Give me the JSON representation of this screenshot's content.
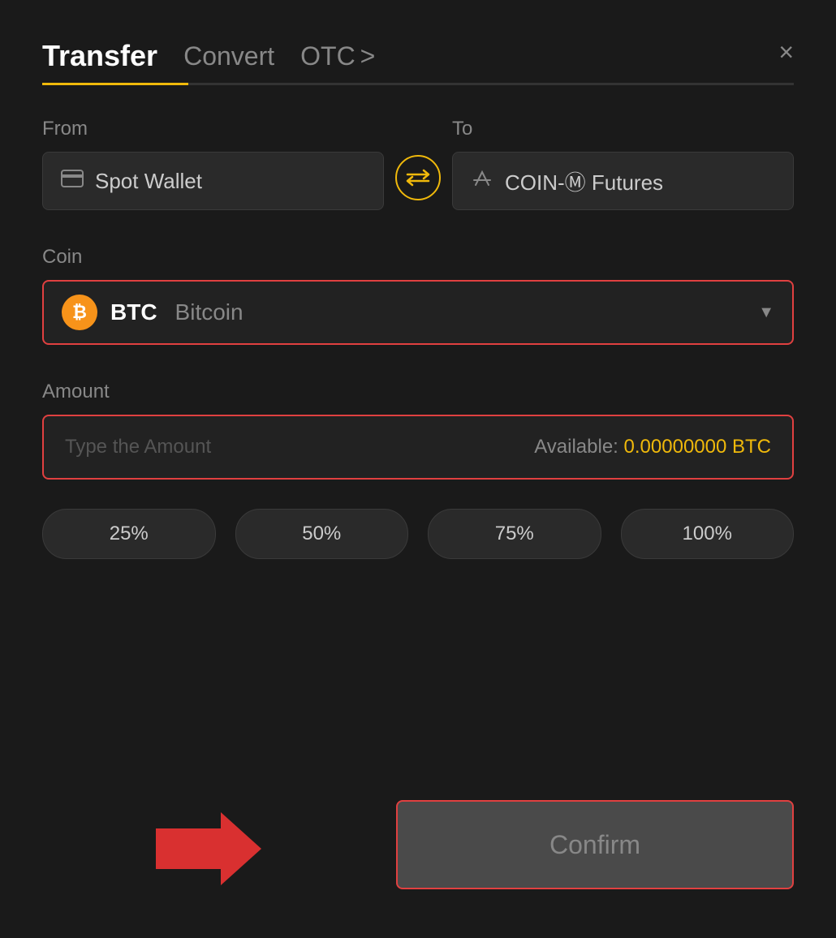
{
  "header": {
    "tab_transfer": "Transfer",
    "tab_convert": "Convert",
    "tab_otc": "OTC",
    "tab_otc_chevron": ">",
    "close_label": "×"
  },
  "from": {
    "label": "From",
    "wallet_name": "Spot Wallet"
  },
  "to": {
    "label": "To",
    "wallet_name": "COIN-Ⓜ Futures"
  },
  "coin": {
    "label": "Coin",
    "symbol": "BTC",
    "full_name": "Bitcoin",
    "chevron": "▼"
  },
  "amount": {
    "label": "Amount",
    "placeholder": "Type the Amount",
    "available_label": "Available:",
    "available_value": "0.00000000 BTC"
  },
  "percentages": [
    {
      "label": "25%"
    },
    {
      "label": "50%"
    },
    {
      "label": "75%"
    },
    {
      "label": "100%"
    }
  ],
  "confirm": {
    "label": "Confirm"
  }
}
